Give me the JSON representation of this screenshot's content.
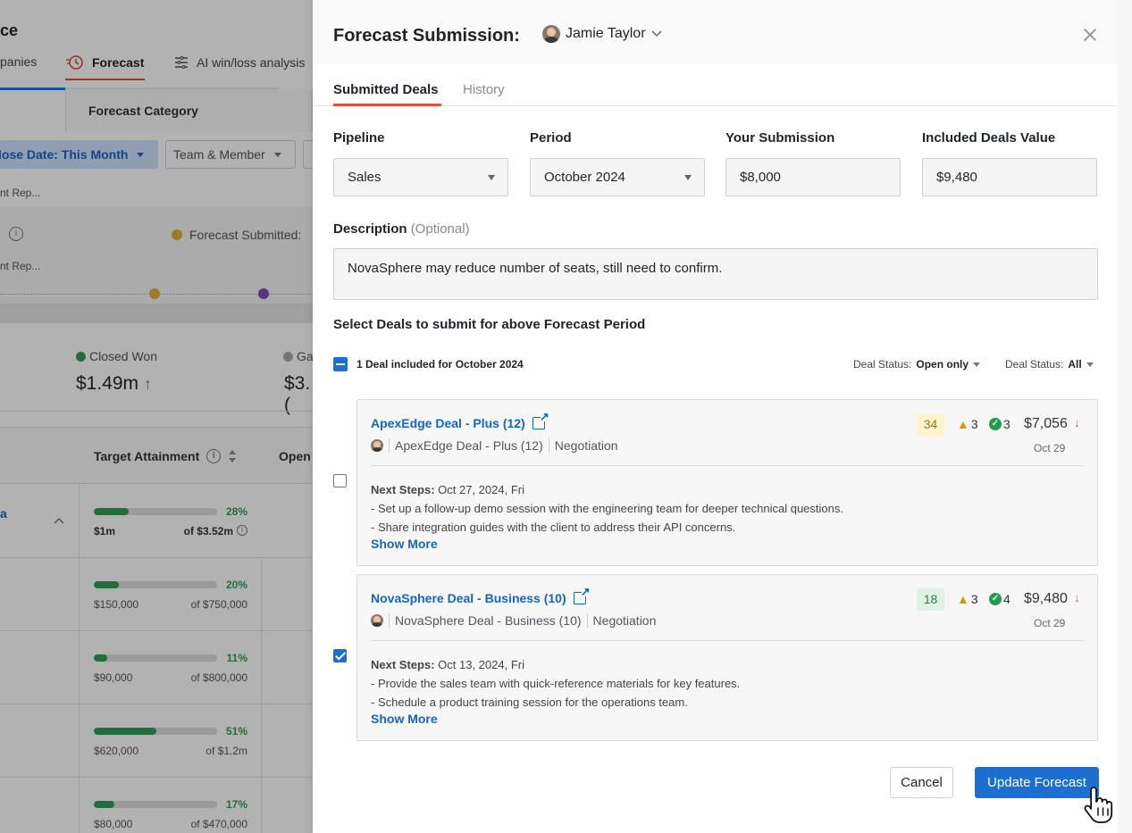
{
  "background": {
    "title": "ce",
    "tabs": [
      {
        "label": "panies"
      },
      {
        "label": "Forecast",
        "icon": "forecast-clock-icon"
      },
      {
        "label": "AI win/loss analysis",
        "icon": "sliders-icon"
      }
    ],
    "category_header": "Forecast Category",
    "filters": {
      "close_date": "lose Date: This Month",
      "team_member": "Team & Member"
    },
    "forecast_submitted_label": "Forecast Submitted:",
    "closed_won": {
      "label": "Closed Won",
      "value": "$1.49m",
      "trend": "↑"
    },
    "gap_label": "Ga",
    "gap_value": "$3.(",
    "columns": {
      "target_attainment": "Target Attainment",
      "open": "Open"
    },
    "group_label": "a",
    "rows": [
      {
        "label": "",
        "pct_text": "28%",
        "pct": 0.28,
        "amount": "$1m",
        "of": "of $3.52m",
        "bold": true
      },
      {
        "label": "nt Rep...",
        "pct_text": "20%",
        "pct": 0.2,
        "amount": "$150,000",
        "of": "of $750,000"
      },
      {
        "label": "nt Rep...",
        "pct_text": "11%",
        "pct": 0.11,
        "amount": "$90,000",
        "of": "of $800,000"
      },
      {
        "label": "",
        "pct_text": "51%",
        "pct": 0.51,
        "amount": "$620,000",
        "of": "of $1.2m"
      },
      {
        "label": "",
        "pct_text": "17%",
        "pct": 0.17,
        "amount": "$80,000",
        "of": "of $470,000"
      }
    ]
  },
  "panel": {
    "title": "Forecast Submission:",
    "user": "Jamie Taylor",
    "tabs": {
      "submitted": "Submitted Deals",
      "history": "History"
    },
    "fields": {
      "pipeline": {
        "label": "Pipeline",
        "value": "Sales"
      },
      "period": {
        "label": "Period",
        "value": "October 2024"
      },
      "submission": {
        "label": "Your Submission",
        "value": "$8,000"
      },
      "included": {
        "label": "Included Deals Value",
        "value": "$9,480"
      }
    },
    "description": {
      "label": "Description",
      "optional": "(Optional)",
      "value": "NovaSphere may reduce number of seats, still need to confirm."
    },
    "select_title": "Select Deals to submit for above Forecast Period",
    "included_text": "1 Deal included for October 2024",
    "deal_status_1": {
      "label": "Deal Status:",
      "value": "Open only"
    },
    "deal_status_2": {
      "label": "Deal Status:",
      "value": "All"
    },
    "deals": [
      {
        "name": "ApexEdge Deal - Plus (12)",
        "sub_name": "ApexEdge Deal - Plus (12)",
        "stage": "Negotiation",
        "score": "34",
        "score_bg": "#fff4cc",
        "score_color": "#a07800",
        "warnings": "3",
        "checks": "3",
        "amount": "$7,056",
        "date": "Oct 29",
        "next_label": "Next Steps:",
        "next_date": "Oct 27, 2024, Fri",
        "step1": "- Set up a follow-up demo session with the engineering team for deeper technical questions.",
        "step2": "- Share integration guides with the client to address their API concerns.",
        "show_more": "Show More",
        "checked": false
      },
      {
        "name": "NovaSphere Deal - Business (10)",
        "sub_name": "NovaSphere Deal - Business (10)",
        "stage": "Negotiation",
        "score": "18",
        "score_bg": "#dff3e4",
        "score_color": "#1e8a45",
        "warnings": "3",
        "checks": "4",
        "amount": "$9,480",
        "date": "Oct 29",
        "next_label": "Next Steps:",
        "next_date": "Oct 13, 2024, Fri",
        "step1": "- Provide the sales team with quick-reference materials for key features.",
        "step2": "- Schedule a product training session for the operations team.",
        "show_more": "Show More",
        "checked": true
      }
    ],
    "buttons": {
      "cancel": "Cancel",
      "update": "Update Forecast"
    },
    "colors": {
      "accent": "#1a6fd0",
      "tab_underline": "#e0503a",
      "positive": "#2e9e55",
      "negative": "#e04a3a"
    }
  }
}
